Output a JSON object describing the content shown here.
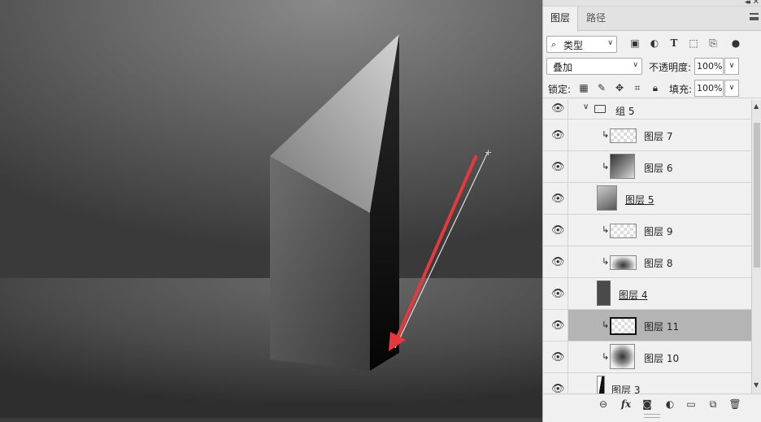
{
  "panel": {
    "tabs": [
      {
        "label": "图层"
      },
      {
        "label": "路径"
      }
    ],
    "filter": {
      "label": "类型"
    },
    "blend_mode": "叠加",
    "opacity_label": "不透明度:",
    "opacity_value": "100%",
    "lock_label": "锁定:",
    "fill_label": "填充:",
    "fill_value": "100%",
    "layers": [
      {
        "name": "组 5",
        "type": "group",
        "expanded": true
      },
      {
        "name": "图层 7",
        "clipped": true
      },
      {
        "name": "图层 6",
        "clipped": true
      },
      {
        "name": "图层 5",
        "clipped": false,
        "underlined": true
      },
      {
        "name": "图层 9",
        "clipped": true
      },
      {
        "name": "图层 8",
        "clipped": true
      },
      {
        "name": "图层 4",
        "clipped": false,
        "underlined": true
      },
      {
        "name": "图层 11",
        "clipped": true,
        "selected": true
      },
      {
        "name": "图层 10",
        "clipped": true
      },
      {
        "name": "图层 3",
        "clipped": false
      }
    ],
    "bottom_icons": [
      "link-icon",
      "fx-icon",
      "mask-icon",
      "adjustment-icon",
      "folder-icon",
      "new-layer-icon",
      "trash-icon"
    ]
  },
  "colors": {
    "selected_row": "#b4b4b4",
    "arrow": "#e8383d",
    "panel_bg": "#f0f0f0"
  }
}
